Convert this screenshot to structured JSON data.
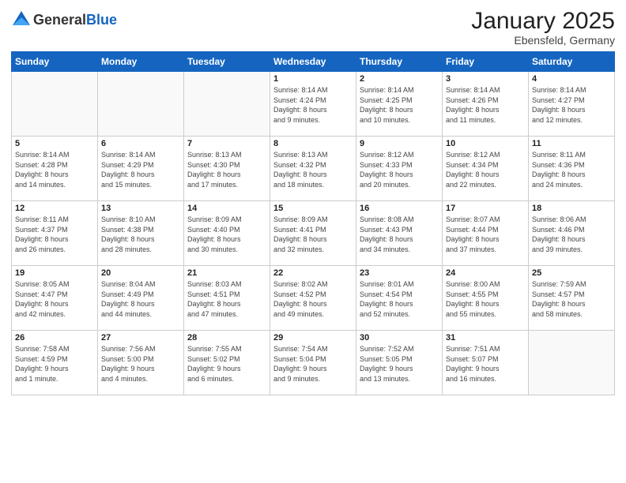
{
  "logo": {
    "general": "General",
    "blue": "Blue"
  },
  "header": {
    "month": "January 2025",
    "location": "Ebensfeld, Germany"
  },
  "weekdays": [
    "Sunday",
    "Monday",
    "Tuesday",
    "Wednesday",
    "Thursday",
    "Friday",
    "Saturday"
  ],
  "weeks": [
    [
      {
        "day": "",
        "sunrise": "",
        "sunset": "",
        "daylight": ""
      },
      {
        "day": "",
        "sunrise": "",
        "sunset": "",
        "daylight": ""
      },
      {
        "day": "",
        "sunrise": "",
        "sunset": "",
        "daylight": ""
      },
      {
        "day": "1",
        "sunrise": "Sunrise: 8:14 AM",
        "sunset": "Sunset: 4:24 PM",
        "daylight": "Daylight: 8 hours and 9 minutes."
      },
      {
        "day": "2",
        "sunrise": "Sunrise: 8:14 AM",
        "sunset": "Sunset: 4:25 PM",
        "daylight": "Daylight: 8 hours and 10 minutes."
      },
      {
        "day": "3",
        "sunrise": "Sunrise: 8:14 AM",
        "sunset": "Sunset: 4:26 PM",
        "daylight": "Daylight: 8 hours and 11 minutes."
      },
      {
        "day": "4",
        "sunrise": "Sunrise: 8:14 AM",
        "sunset": "Sunset: 4:27 PM",
        "daylight": "Daylight: 8 hours and 12 minutes."
      }
    ],
    [
      {
        "day": "5",
        "sunrise": "Sunrise: 8:14 AM",
        "sunset": "Sunset: 4:28 PM",
        "daylight": "Daylight: 8 hours and 14 minutes."
      },
      {
        "day": "6",
        "sunrise": "Sunrise: 8:14 AM",
        "sunset": "Sunset: 4:29 PM",
        "daylight": "Daylight: 8 hours and 15 minutes."
      },
      {
        "day": "7",
        "sunrise": "Sunrise: 8:13 AM",
        "sunset": "Sunset: 4:30 PM",
        "daylight": "Daylight: 8 hours and 17 minutes."
      },
      {
        "day": "8",
        "sunrise": "Sunrise: 8:13 AM",
        "sunset": "Sunset: 4:32 PM",
        "daylight": "Daylight: 8 hours and 18 minutes."
      },
      {
        "day": "9",
        "sunrise": "Sunrise: 8:12 AM",
        "sunset": "Sunset: 4:33 PM",
        "daylight": "Daylight: 8 hours and 20 minutes."
      },
      {
        "day": "10",
        "sunrise": "Sunrise: 8:12 AM",
        "sunset": "Sunset: 4:34 PM",
        "daylight": "Daylight: 8 hours and 22 minutes."
      },
      {
        "day": "11",
        "sunrise": "Sunrise: 8:11 AM",
        "sunset": "Sunset: 4:36 PM",
        "daylight": "Daylight: 8 hours and 24 minutes."
      }
    ],
    [
      {
        "day": "12",
        "sunrise": "Sunrise: 8:11 AM",
        "sunset": "Sunset: 4:37 PM",
        "daylight": "Daylight: 8 hours and 26 minutes."
      },
      {
        "day": "13",
        "sunrise": "Sunrise: 8:10 AM",
        "sunset": "Sunset: 4:38 PM",
        "daylight": "Daylight: 8 hours and 28 minutes."
      },
      {
        "day": "14",
        "sunrise": "Sunrise: 8:09 AM",
        "sunset": "Sunset: 4:40 PM",
        "daylight": "Daylight: 8 hours and 30 minutes."
      },
      {
        "day": "15",
        "sunrise": "Sunrise: 8:09 AM",
        "sunset": "Sunset: 4:41 PM",
        "daylight": "Daylight: 8 hours and 32 minutes."
      },
      {
        "day": "16",
        "sunrise": "Sunrise: 8:08 AM",
        "sunset": "Sunset: 4:43 PM",
        "daylight": "Daylight: 8 hours and 34 minutes."
      },
      {
        "day": "17",
        "sunrise": "Sunrise: 8:07 AM",
        "sunset": "Sunset: 4:44 PM",
        "daylight": "Daylight: 8 hours and 37 minutes."
      },
      {
        "day": "18",
        "sunrise": "Sunrise: 8:06 AM",
        "sunset": "Sunset: 4:46 PM",
        "daylight": "Daylight: 8 hours and 39 minutes."
      }
    ],
    [
      {
        "day": "19",
        "sunrise": "Sunrise: 8:05 AM",
        "sunset": "Sunset: 4:47 PM",
        "daylight": "Daylight: 8 hours and 42 minutes."
      },
      {
        "day": "20",
        "sunrise": "Sunrise: 8:04 AM",
        "sunset": "Sunset: 4:49 PM",
        "daylight": "Daylight: 8 hours and 44 minutes."
      },
      {
        "day": "21",
        "sunrise": "Sunrise: 8:03 AM",
        "sunset": "Sunset: 4:51 PM",
        "daylight": "Daylight: 8 hours and 47 minutes."
      },
      {
        "day": "22",
        "sunrise": "Sunrise: 8:02 AM",
        "sunset": "Sunset: 4:52 PM",
        "daylight": "Daylight: 8 hours and 49 minutes."
      },
      {
        "day": "23",
        "sunrise": "Sunrise: 8:01 AM",
        "sunset": "Sunset: 4:54 PM",
        "daylight": "Daylight: 8 hours and 52 minutes."
      },
      {
        "day": "24",
        "sunrise": "Sunrise: 8:00 AM",
        "sunset": "Sunset: 4:55 PM",
        "daylight": "Daylight: 8 hours and 55 minutes."
      },
      {
        "day": "25",
        "sunrise": "Sunrise: 7:59 AM",
        "sunset": "Sunset: 4:57 PM",
        "daylight": "Daylight: 8 hours and 58 minutes."
      }
    ],
    [
      {
        "day": "26",
        "sunrise": "Sunrise: 7:58 AM",
        "sunset": "Sunset: 4:59 PM",
        "daylight": "Daylight: 9 hours and 1 minute."
      },
      {
        "day": "27",
        "sunrise": "Sunrise: 7:56 AM",
        "sunset": "Sunset: 5:00 PM",
        "daylight": "Daylight: 9 hours and 4 minutes."
      },
      {
        "day": "28",
        "sunrise": "Sunrise: 7:55 AM",
        "sunset": "Sunset: 5:02 PM",
        "daylight": "Daylight: 9 hours and 6 minutes."
      },
      {
        "day": "29",
        "sunrise": "Sunrise: 7:54 AM",
        "sunset": "Sunset: 5:04 PM",
        "daylight": "Daylight: 9 hours and 9 minutes."
      },
      {
        "day": "30",
        "sunrise": "Sunrise: 7:52 AM",
        "sunset": "Sunset: 5:05 PM",
        "daylight": "Daylight: 9 hours and 13 minutes."
      },
      {
        "day": "31",
        "sunrise": "Sunrise: 7:51 AM",
        "sunset": "Sunset: 5:07 PM",
        "daylight": "Daylight: 9 hours and 16 minutes."
      },
      {
        "day": "",
        "sunrise": "",
        "sunset": "",
        "daylight": ""
      }
    ]
  ]
}
